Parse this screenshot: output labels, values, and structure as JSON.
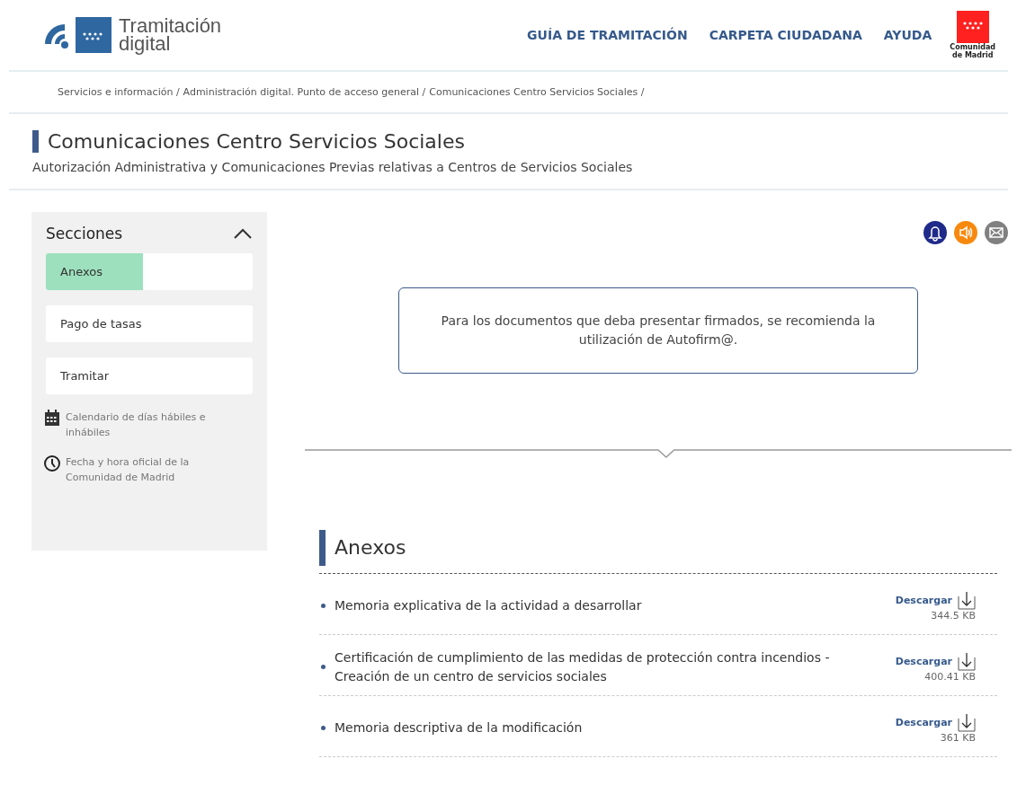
{
  "header": {
    "logo_text": [
      "Tramitación",
      "digital"
    ],
    "nav": [
      "GUÍA DE TRAMITACIÓN",
      "CARPETA CIUDADANA",
      "AYUDA"
    ],
    "region_logo_text": [
      "Comunidad",
      "de Madrid"
    ]
  },
  "breadcrumb": [
    "Servicios e información /",
    "Administración digital. Punto de acceso general /",
    "Comunicaciones Centro Servicios Sociales /"
  ],
  "page": {
    "title": "Comunicaciones Centro Servicios Sociales",
    "subtitle": "Autorización Administrativa y Comunicaciones Previas relativas a Centros de Servicios Sociales"
  },
  "sidebar": {
    "title": "Secciones",
    "expanded": true,
    "items": [
      {
        "label": "Anexos",
        "selected": true
      },
      {
        "label": "Pago de tasas",
        "selected": false
      },
      {
        "label": "Tramitar",
        "selected": false
      }
    ],
    "links": [
      {
        "kind": "calendar",
        "label": "Calendario de días hábiles e inhábiles"
      },
      {
        "kind": "clock",
        "label": "Fecha y hora oficial de la Comunidad de Madrid"
      }
    ]
  },
  "notice": "Para los documentos que deba presentar firmados, se recomienda la utilización de Autofirm@.",
  "annexes": {
    "title": "Anexos",
    "items": [
      {
        "text": "Memoria explicativa de la actividad a desarrollar",
        "action": "Descargar",
        "size": "344.5 KB"
      },
      {
        "text": "Certificación de cumplimiento de las medidas de protección contra incendios - Creación de un centro de servicios sociales",
        "action": "Descargar",
        "size": "400.41 KB"
      },
      {
        "text": "Memoria descriptiva de la modificación",
        "action": "Descargar",
        "size": "361 KB"
      }
    ]
  }
}
